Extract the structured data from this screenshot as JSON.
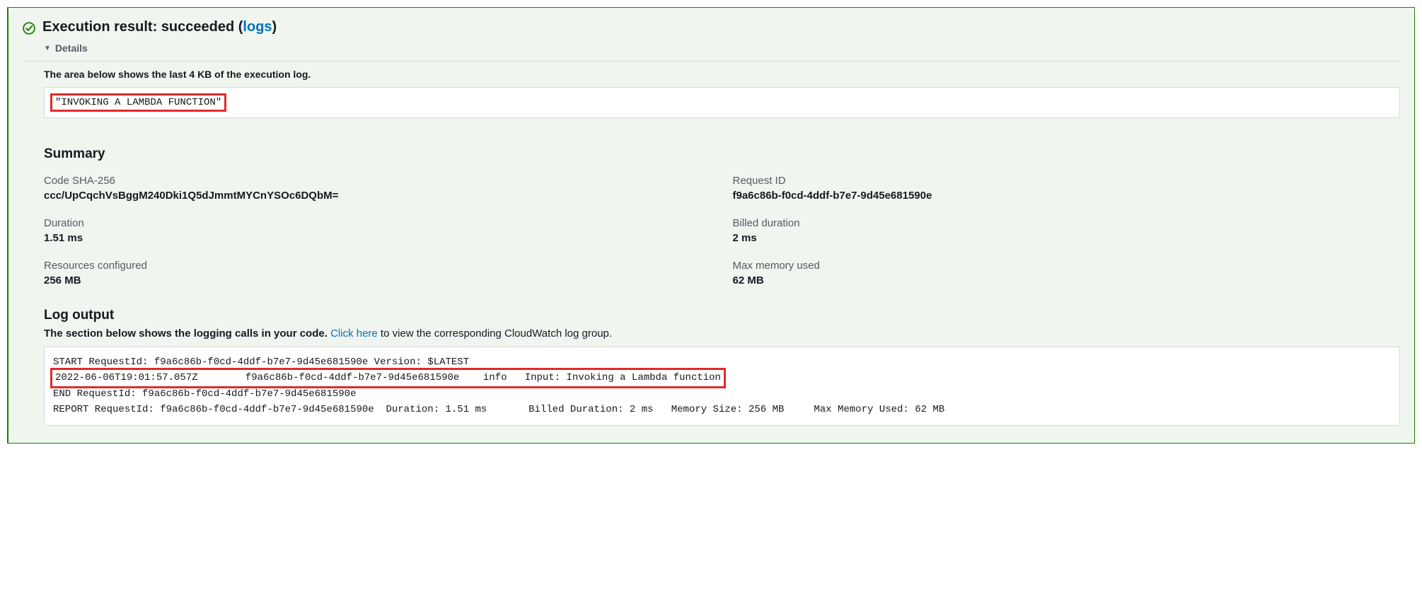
{
  "header": {
    "prefix": "Execution result: ",
    "status": "succeeded",
    "open_paren": " (",
    "logs_link": "logs",
    "close_paren": ")"
  },
  "details_toggle_label": "Details",
  "execution_log_note": "The area below shows the last 4 KB of the execution log.",
  "result_output": "\"INVOKING A LAMBDA FUNCTION\"",
  "summary": {
    "heading": "Summary",
    "code_sha256": {
      "label": "Code SHA-256",
      "value": "ccc/UpCqchVsBggM240Dki1Q5dJmmtMYCnYSOc6DQbM="
    },
    "request_id": {
      "label": "Request ID",
      "value": "f9a6c86b-f0cd-4ddf-b7e7-9d45e681590e"
    },
    "duration": {
      "label": "Duration",
      "value": "1.51 ms"
    },
    "billed_duration": {
      "label": "Billed duration",
      "value": "2 ms"
    },
    "resources_configured": {
      "label": "Resources configured",
      "value": "256 MB"
    },
    "max_memory_used": {
      "label": "Max memory used",
      "value": "62 MB"
    }
  },
  "log_output": {
    "heading": "Log output",
    "note_prefix": "The section below shows the logging calls in your code. ",
    "click_here": "Click here",
    "note_suffix": " to view the corresponding CloudWatch log group.",
    "lines": {
      "l0": "START RequestId: f9a6c86b-f0cd-4ddf-b7e7-9d45e681590e Version: $LATEST",
      "l1": "2022-06-06T19:01:57.057Z\tf9a6c86b-f0cd-4ddf-b7e7-9d45e681590e    info   Input: Invoking a Lambda function",
      "l2": "END RequestId: f9a6c86b-f0cd-4ddf-b7e7-9d45e681590e",
      "l3": "REPORT RequestId: f9a6c86b-f0cd-4ddf-b7e7-9d45e681590e  Duration: 1.51 ms\tBilled Duration: 2 ms\tMemory Size: 256 MB\tMax Memory Used: 62 MB"
    }
  }
}
